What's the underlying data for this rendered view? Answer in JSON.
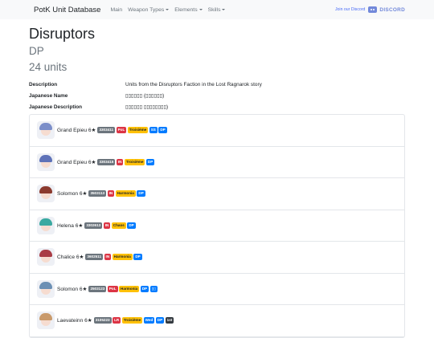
{
  "nav": {
    "brand": "PotK Unit Database",
    "items": [
      {
        "label": "Main",
        "dropdown": false
      },
      {
        "label": "Weapon Types",
        "dropdown": true
      },
      {
        "label": "Elements",
        "dropdown": true
      },
      {
        "label": "Skills",
        "dropdown": true
      }
    ],
    "discord_join": "Join our Discord",
    "discord_word": "DISCORD"
  },
  "page": {
    "title": "Disruptors",
    "subtitle": "DP",
    "count": "24 units",
    "info": [
      {
        "key": "Description",
        "value": "Units from the Disruptors Faction in the Lost Ragnarok story"
      },
      {
        "key": "Japanese Name",
        "value": "▯▯▯▯▯▯ (▯▯▯▯▯▯)"
      },
      {
        "key": "Japanese Description",
        "value": "▯▯▯▯▯▯ ▯▯▯▯▯▯▯▯)"
      }
    ]
  },
  "units": [
    {
      "name": "Grand Epieu 6★",
      "avatar_hair": "#7b8ec9",
      "badges": [
        {
          "text": "3303411",
          "kind": "id"
        },
        {
          "text": "PoL",
          "kind": "pol"
        },
        {
          "text": "Troisième",
          "kind": "trai"
        },
        {
          "text": "SS",
          "kind": "blue"
        },
        {
          "text": "DP",
          "kind": "blue"
        }
      ]
    },
    {
      "name": "Grand Epieu 6★",
      "avatar_hair": "#5e72b8",
      "badges": [
        {
          "text": "3303415",
          "kind": "id"
        },
        {
          "text": "IN",
          "kind": "in"
        },
        {
          "text": "Troisième",
          "kind": "trai"
        },
        {
          "text": "DP",
          "kind": "blue"
        }
      ]
    },
    {
      "name": "Solomon 6★",
      "avatar_hair": "#8b3a2e",
      "badges": [
        {
          "text": "3503113",
          "kind": "id"
        },
        {
          "text": "IN",
          "kind": "in"
        },
        {
          "text": "Harmonia",
          "kind": "harm"
        },
        {
          "text": "DP",
          "kind": "blue"
        }
      ]
    },
    {
      "name": "Helena 6★",
      "avatar_hair": "#3aa9a1",
      "badges": [
        {
          "text": "3302613",
          "kind": "id"
        },
        {
          "text": "IN",
          "kind": "in"
        },
        {
          "text": "Chaos",
          "kind": "chao"
        },
        {
          "text": "DP",
          "kind": "blue"
        }
      ]
    },
    {
      "name": "Chalice 6★",
      "avatar_hair": "#a93c45",
      "badges": [
        {
          "text": "3602511",
          "kind": "id"
        },
        {
          "text": "IN",
          "kind": "in"
        },
        {
          "text": "Harmonia",
          "kind": "harm"
        },
        {
          "text": "DP",
          "kind": "blue"
        }
      ]
    },
    {
      "name": "Solomon 6★",
      "avatar_hair": "#6b8fb4",
      "badges": [
        {
          "text": "2503123",
          "kind": "id"
        },
        {
          "text": "PoL",
          "kind": "pol"
        },
        {
          "text": "Harmonia",
          "kind": "harm"
        },
        {
          "text": "DP",
          "kind": "blue"
        },
        {
          "text": "▯▯",
          "kind": "blue"
        }
      ]
    },
    {
      "name": "Laevateinn 6★",
      "avatar_hair": "#c99a6b",
      "badges": [
        {
          "text": "3105223",
          "kind": "id"
        },
        {
          "text": "LR",
          "kind": "lr"
        },
        {
          "text": "Troisième",
          "kind": "trai"
        },
        {
          "text": "Wed",
          "kind": "blue"
        },
        {
          "text": "DP",
          "kind": "blue"
        },
        {
          "text": "1st",
          "kind": "dark"
        }
      ]
    }
  ]
}
